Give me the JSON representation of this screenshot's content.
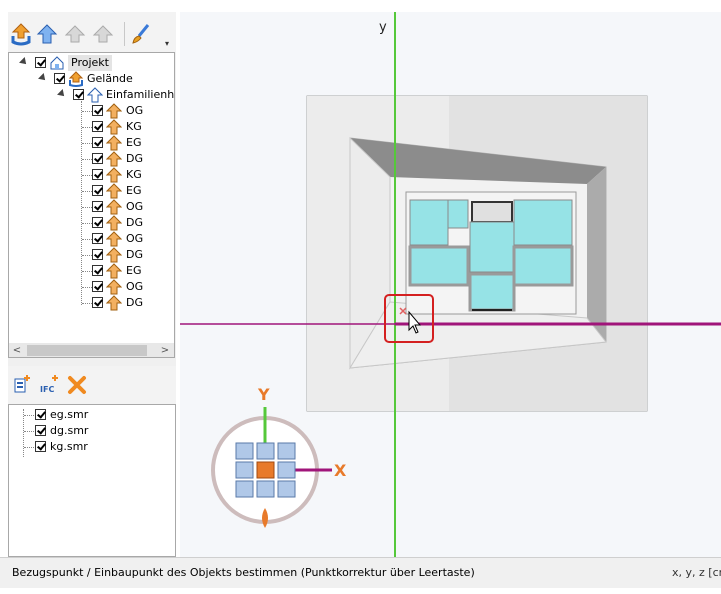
{
  "tree": {
    "root": "Projekt",
    "site": "Gelände",
    "building": "Einfamilienhau",
    "floors": [
      "OG",
      "KG",
      "EG",
      "DG",
      "KG",
      "EG",
      "OG",
      "DG",
      "OG",
      "DG",
      "EG",
      "OG",
      "DG"
    ]
  },
  "files": [
    "eg.smr",
    "dg.smr",
    "kg.smr"
  ],
  "toolbar2": {
    "ifc_label": "IFC"
  },
  "viewport": {
    "y_axis_label": "y",
    "gizmo_y": "Y",
    "gizmo_x": "X"
  },
  "status": {
    "message": "Bezugspunkt / Einbaupunkt des Objekts bestimmen (Punktkorrektur über Leertaste)",
    "coords": "x, y, z [cr"
  },
  "colors": {
    "room_fill": "#96e3e6",
    "x_axis": "#a0157a",
    "y_axis": "#55c83a",
    "highlight": "#d42020",
    "gizmo_orange": "#e87a2a"
  }
}
